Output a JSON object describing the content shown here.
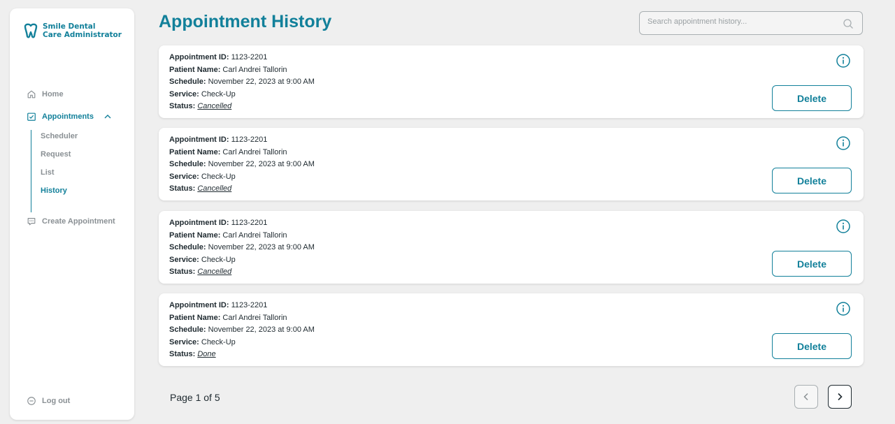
{
  "brand": {
    "line1": "Smile Dental",
    "line2": "Care Administrator",
    "color": "#12809a"
  },
  "sidebar": {
    "home": "Home",
    "appointments": "Appointments",
    "sub": [
      "Scheduler",
      "Request",
      "List",
      "History"
    ],
    "active_sub": "History",
    "create": "Create Appointment",
    "logout": "Log out"
  },
  "header": {
    "title": "Appointment History",
    "search_placeholder": "Search appointment history..."
  },
  "labels": {
    "id": "Appointment ID:",
    "patient": "Patient Name:",
    "schedule": "Schedule:",
    "service": "Service:",
    "status": "Status:",
    "delete": "Delete"
  },
  "appointments": [
    {
      "id": "1123-2201",
      "patient": "Carl Andrei Tallorin",
      "schedule": "November 22, 2023 at 9:00 AM",
      "service": "Check-Up",
      "status": "Cancelled"
    },
    {
      "id": "1123-2201",
      "patient": "Carl Andrei Tallorin",
      "schedule": "November 22, 2023 at 9:00 AM",
      "service": "Check-Up",
      "status": "Cancelled"
    },
    {
      "id": "1123-2201",
      "patient": "Carl Andrei Tallorin",
      "schedule": "November 22, 2023 at 9:00 AM",
      "service": "Check-Up",
      "status": "Cancelled"
    },
    {
      "id": "1123-2201",
      "patient": "Carl Andrei Tallorin",
      "schedule": "November 22, 2023 at 9:00 AM",
      "service": "Check-Up",
      "status": "Done"
    }
  ],
  "pagination": {
    "text": "Page 1 of 5"
  },
  "icons": {
    "home": "home-icon",
    "appointments": "calendar-check-icon",
    "create": "chat-plus-icon",
    "logout": "logout-icon",
    "info": "info-icon",
    "search": "search-icon"
  }
}
